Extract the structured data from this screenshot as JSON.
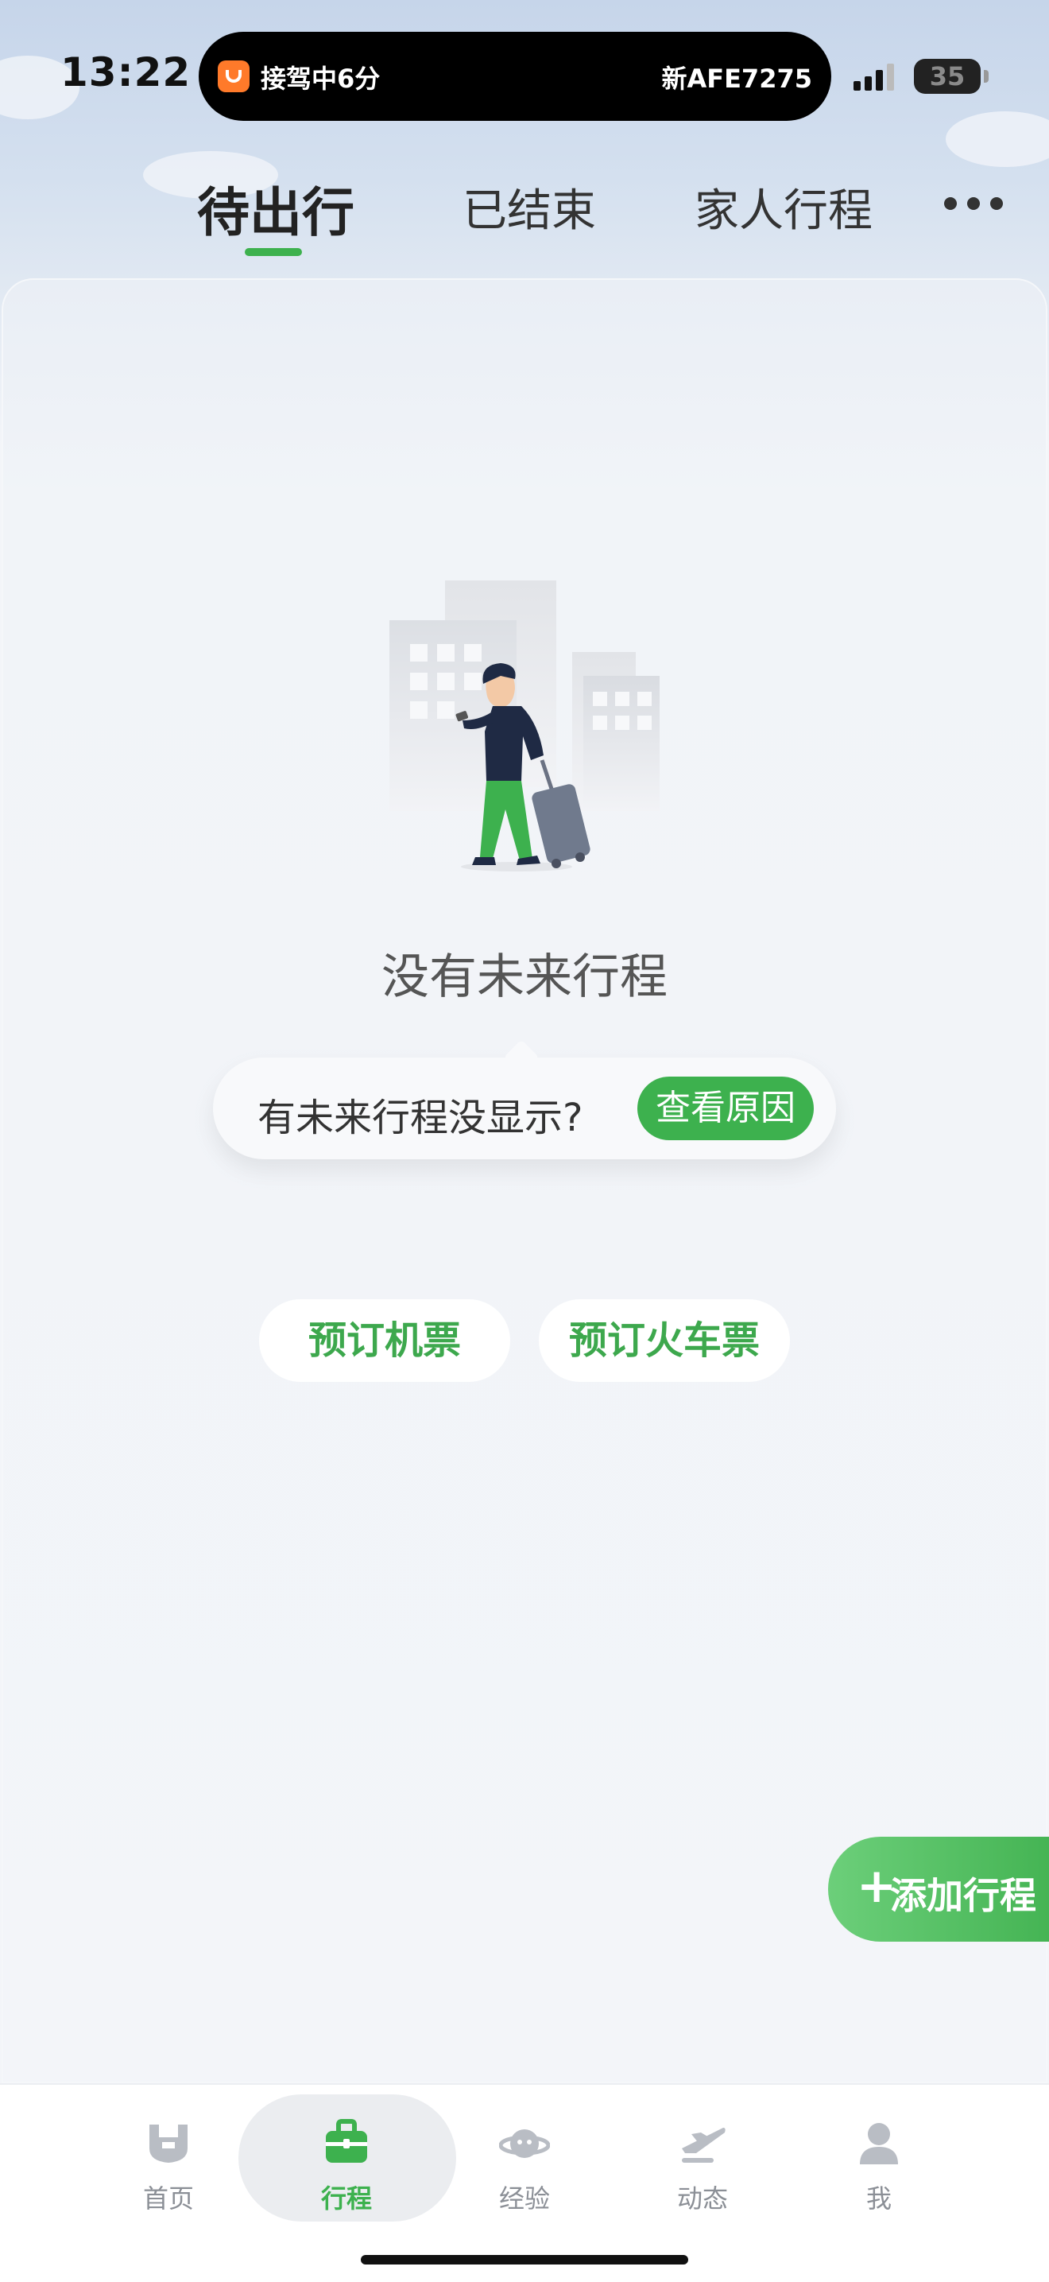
{
  "status_bar": {
    "time": "13:22",
    "island_left": "接驾中6分",
    "island_right": "新AFE7275",
    "battery": "35"
  },
  "tabs": [
    {
      "label": "待出行",
      "active": true
    },
    {
      "label": "已结束",
      "active": false
    },
    {
      "label": "家人行程",
      "active": false
    }
  ],
  "empty_state": {
    "title": "没有未来行程",
    "hint_text": "有未来行程没显示?",
    "hint_button": "查看原因"
  },
  "quick_actions": {
    "book_flight": "预订机票",
    "book_train": "预订火车票"
  },
  "fab": {
    "label": "添加行程"
  },
  "nav": [
    {
      "label": "首页",
      "icon": "home-icon",
      "active": false
    },
    {
      "label": "行程",
      "icon": "briefcase-icon",
      "active": true
    },
    {
      "label": "经验",
      "icon": "planet-icon",
      "active": false
    },
    {
      "label": "动态",
      "icon": "airplane-icon",
      "active": false
    },
    {
      "label": "我",
      "icon": "user-icon",
      "active": false
    }
  ],
  "colors": {
    "accent": "#3db14e",
    "background": "#f3f5f9",
    "sky_top": "#c6d5ea"
  }
}
